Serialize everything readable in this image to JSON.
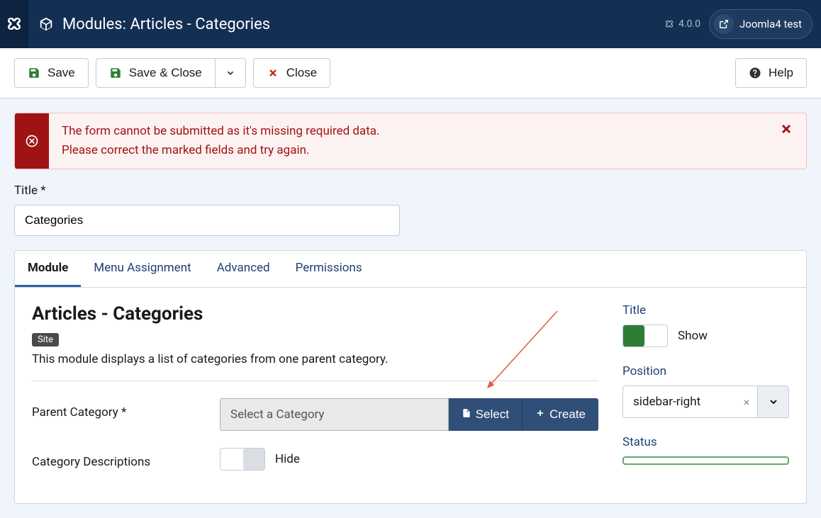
{
  "header": {
    "page_title": "Modules: Articles - Categories",
    "version": "4.0.0",
    "site_name": "Joomla4 test"
  },
  "toolbar": {
    "save": "Save",
    "save_close": "Save & Close",
    "close": "Close",
    "help": "Help"
  },
  "alert": {
    "line1": "The form cannot be submitted as it's missing required data.",
    "line2": "Please correct the marked fields and try again."
  },
  "title_field": {
    "label": "Title *",
    "value": "Categories"
  },
  "tabs": [
    {
      "label": "Module"
    },
    {
      "label": "Menu Assignment"
    },
    {
      "label": "Advanced"
    },
    {
      "label": "Permissions"
    }
  ],
  "module": {
    "heading": "Articles - Categories",
    "badge": "Site",
    "description": "This module displays a list of categories from one parent category.",
    "parent_category": {
      "label": "Parent Category *",
      "placeholder": "Select a Category",
      "select_btn": "Select",
      "create_btn": "Create"
    },
    "category_descriptions": {
      "label": "Category Descriptions",
      "value_label": "Hide"
    }
  },
  "sidebar": {
    "title": {
      "label": "Title",
      "value_label": "Show"
    },
    "position": {
      "label": "Position",
      "value": "sidebar-right"
    },
    "status": {
      "label": "Status"
    }
  }
}
